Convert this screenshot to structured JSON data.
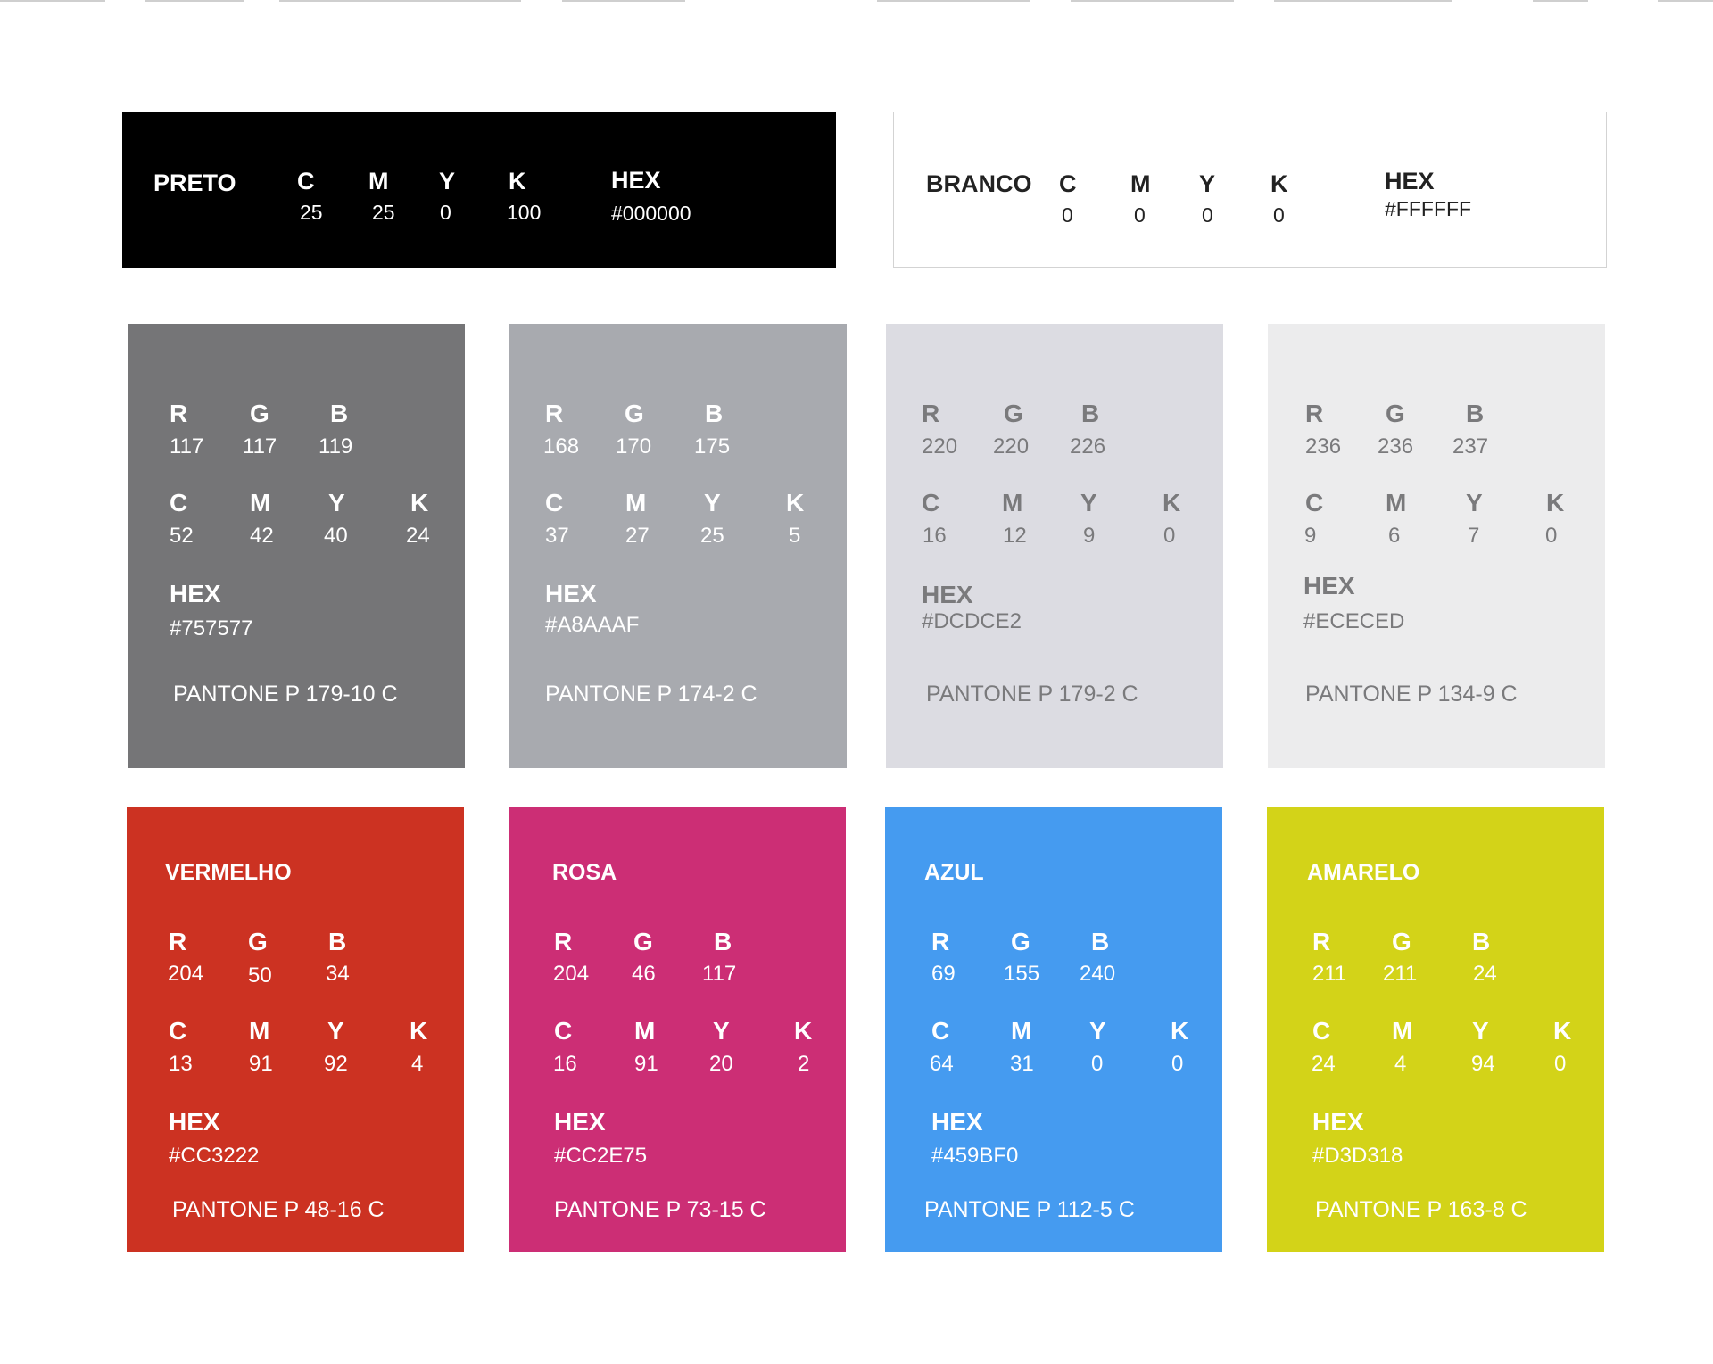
{
  "preto": {
    "name": "PRETO",
    "color": "#000000",
    "c_label": "C",
    "m_label": "M",
    "y_label": "Y",
    "k_label": "K",
    "hex_label": "HEX",
    "c": "25",
    "m": "25",
    "y": "0",
    "k": "100",
    "hex": "#000000"
  },
  "branco": {
    "name": "BRANCO",
    "color": "#FFFFFF",
    "c_label": "C",
    "m_label": "M",
    "y_label": "Y",
    "k_label": "K",
    "hex_label": "HEX",
    "c": "0",
    "m": "0",
    "y": "0",
    "k": "0",
    "hex": "#FFFFFF"
  },
  "cards": [
    {
      "name": "",
      "color": "#757577",
      "text_color": "#ffffff",
      "r_label": "R",
      "g_label": "G",
      "b_label": "B",
      "c_label": "C",
      "m_label": "M",
      "y_label": "Y",
      "k_label": "K",
      "hex_label": "HEX",
      "r": "117",
      "g": "117",
      "b": "119",
      "c": "52",
      "m": "42",
      "y": "40",
      "k": "24",
      "hex": "#757577",
      "pantone": "PANTONE P 179-10 C"
    },
    {
      "name": "",
      "color": "#A8AAAF",
      "text_color": "#ffffff",
      "r_label": "R",
      "g_label": "G",
      "b_label": "B",
      "c_label": "C",
      "m_label": "M",
      "y_label": "Y",
      "k_label": "K",
      "hex_label": "HEX",
      "r": "168",
      "g": "170",
      "b": "175",
      "c": "37",
      "m": "27",
      "y": "25",
      "k": "5",
      "hex": "#A8AAAF",
      "pantone": "PANTONE P 174-2 C"
    },
    {
      "name": "",
      "color": "#DCDCE2",
      "text_color": "#7a7a7c",
      "r_label": "R",
      "g_label": "G",
      "b_label": "B",
      "c_label": "C",
      "m_label": "M",
      "y_label": "Y",
      "k_label": "K",
      "hex_label": "HEX",
      "r": "220",
      "g": "220",
      "b": "226",
      "c": "16",
      "m": "12",
      "y": "9",
      "k": "0",
      "hex": "#DCDCE2",
      "pantone": "PANTONE P 179-2 C"
    },
    {
      "name": "",
      "color": "#ECECED",
      "text_color": "#7a7a7c",
      "r_label": "R",
      "g_label": "G",
      "b_label": "B",
      "c_label": "C",
      "m_label": "M",
      "y_label": "Y",
      "k_label": "K",
      "hex_label": "HEX",
      "r": "236",
      "g": "236",
      "b": "237",
      "c": "9",
      "m": "6",
      "y": "7",
      "k": "0",
      "hex": "#ECECED",
      "pantone": "PANTONE P 134-9 C"
    },
    {
      "name": "VERMELHO",
      "color": "#CC3222",
      "text_color": "#ffffff",
      "r_label": "R",
      "g_label": "G",
      "b_label": "B",
      "c_label": "C",
      "m_label": "M",
      "y_label": "Y",
      "k_label": "K",
      "hex_label": "HEX",
      "r": "204",
      "g": "50",
      "b": "34",
      "c": "13",
      "m": "91",
      "y": "92",
      "k": "4",
      "hex": "#CC3222",
      "pantone": "PANTONE P 48-16 C"
    },
    {
      "name": "ROSA",
      "color": "#CC2E75",
      "text_color": "#ffffff",
      "r_label": "R",
      "g_label": "G",
      "b_label": "B",
      "c_label": "C",
      "m_label": "M",
      "y_label": "Y",
      "k_label": "K",
      "hex_label": "HEX",
      "r": "204",
      "g": "46",
      "b": "117",
      "c": "16",
      "m": "91",
      "y": "20",
      "k": "2",
      "hex": "#CC2E75",
      "pantone": "PANTONE P 73-15 C"
    },
    {
      "name": "AZUL",
      "color": "#459BF0",
      "text_color": "#ffffff",
      "r_label": "R",
      "g_label": "G",
      "b_label": "B",
      "c_label": "C",
      "m_label": "M",
      "y_label": "Y",
      "k_label": "K",
      "hex_label": "HEX",
      "r": "69",
      "g": "155",
      "b": "240",
      "c": "64",
      "m": "31",
      "y": "0",
      "k": "0",
      "hex": "#459BF0",
      "pantone": "PANTONE P 112-5 C"
    },
    {
      "name": "AMARELO",
      "color": "#D3D318",
      "text_color": "#ffffff",
      "r_label": "R",
      "g_label": "G",
      "b_label": "B",
      "c_label": "C",
      "m_label": "M",
      "y_label": "Y",
      "k_label": "K",
      "hex_label": "HEX",
      "r": "211",
      "g": "211",
      "b": "24",
      "c": "24",
      "m": "4",
      "y": "94",
      "k": "0",
      "hex": "#D3D318",
      "pantone": "PANTONE P 163-8 C"
    }
  ]
}
